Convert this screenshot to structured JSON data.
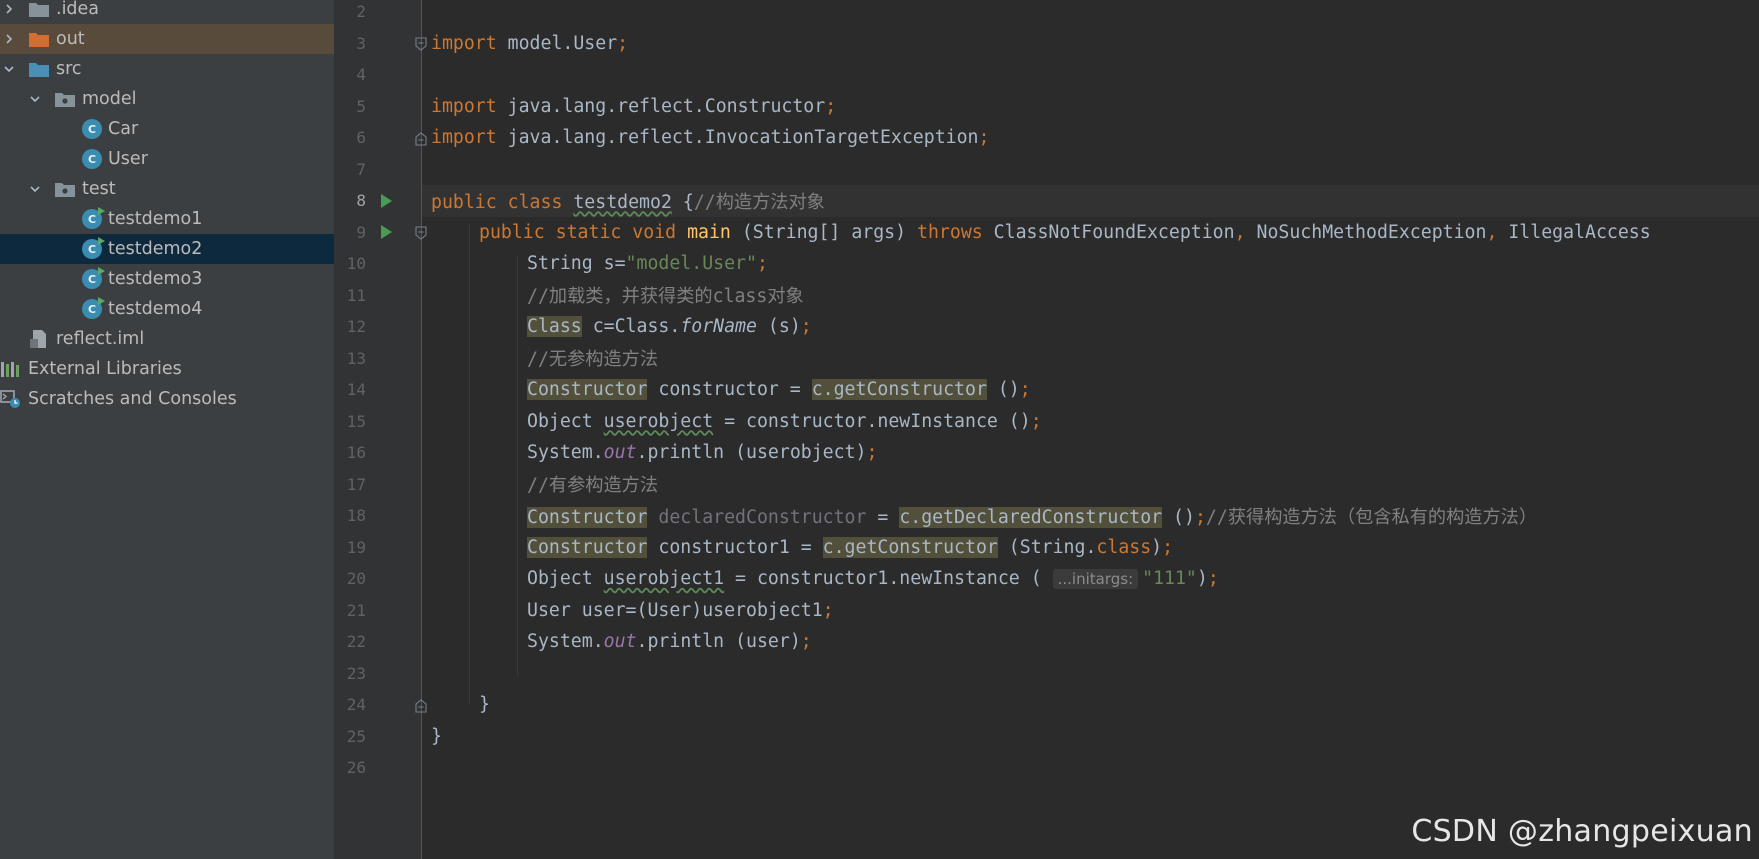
{
  "tree": {
    "items": [
      {
        "label": ".idea",
        "icon": "folder-icon",
        "expanded": false,
        "depth": 0
      },
      {
        "label": "out",
        "icon": "folder-orange-icon",
        "expanded": false,
        "depth": 0
      },
      {
        "label": "src",
        "icon": "folder-source-icon",
        "expanded": true,
        "depth": 0
      },
      {
        "label": "model",
        "icon": "package-icon",
        "expanded": true,
        "depth": 1
      },
      {
        "label": "Car",
        "icon": "class-icon",
        "depth": 2
      },
      {
        "label": "User",
        "icon": "class-icon",
        "depth": 2
      },
      {
        "label": "test",
        "icon": "package-icon",
        "expanded": true,
        "depth": 1
      },
      {
        "label": "testdemo1",
        "icon": "runnable-class-icon",
        "depth": 2
      },
      {
        "label": "testdemo2",
        "icon": "runnable-class-icon",
        "depth": 2,
        "selected": true
      },
      {
        "label": "testdemo3",
        "icon": "runnable-class-icon",
        "depth": 2
      },
      {
        "label": "testdemo4",
        "icon": "runnable-class-icon",
        "depth": 2
      },
      {
        "label": "reflect.iml",
        "icon": "module-file-icon",
        "depth": 1
      },
      {
        "label": "External Libraries",
        "icon": "libraries-icon",
        "depth": 0
      },
      {
        "label": "Scratches and Consoles",
        "icon": "scratches-icon",
        "depth": 0
      }
    ]
  },
  "editor": {
    "current_line": 8,
    "line_numbers": [
      "2",
      "3",
      "4",
      "5",
      "6",
      "7",
      "8",
      "9",
      "10",
      "11",
      "12",
      "13",
      "14",
      "15",
      "16",
      "17",
      "18",
      "19",
      "20",
      "21",
      "22",
      "23",
      "24",
      "25",
      "26"
    ],
    "code": {
      "l3_import": "import",
      "l3_rest": " model.User",
      "semi": ";",
      "l5_rest": " java.lang.reflect.Constructor",
      "l6_rest": " java.lang.reflect.InvocationTargetException",
      "l8_public": "public",
      "l8_class": "class",
      "l8_name": "testdemo2",
      "l8_brace": " {",
      "l8_comment": "//构造方法对象",
      "l9_mods": "public static void",
      "l9_main": "main",
      "l9_params": " (String[] args) ",
      "l9_throws": "throws",
      "l9_ex1": " ClassNotFoundException",
      "comma": ",",
      "l9_ex2": " NoSuchMethodException",
      "l9_ex3": " IllegalAccess",
      "l10_a": "String s=",
      "l10_str": "\"model.User\"",
      "l11_comment": "//加载类，并获得类的class对象",
      "l12_class": "Class",
      "l12_a": " c=Class.",
      "l12_forname": "forName",
      "l12_b": " (s)",
      "l13_comment": "//无参构造方法",
      "constructor_type": "Constructor",
      "l14_a": " constructor = ",
      "l14_call": "c.getConstructor",
      "l14_b": " ()",
      "l15_a": "Object ",
      "l15_var": "userobject",
      "l15_b": " = constructor.newInstance ()",
      "l16_a": "System.",
      "out": "out",
      "l16_b": ".println (userobject)",
      "l17_comment": "//有参构造方法",
      "l18_var": "declaredConstructor",
      "l18_eq": " = ",
      "l18_call": "c.getDeclaredConstructor",
      "l18_b": " ()",
      "l18_comment": "//获得构造方法（包含私有的构造方法）",
      "l19_a": " constructor1 = ",
      "l19_call": "c.getConstructor",
      "l19_b": " (String.",
      "l19_class": "class",
      "l19_c": ")",
      "l20_a": "Object ",
      "l20_var": "userobject1",
      "l20_b": " = constructor1.newInstance ( ",
      "l20_hint": "...initargs:",
      "l20_str": "\"111\"",
      "l20_c": ")",
      "l21_a": "User user=(User)userobject1",
      "l22_b": ".println (user)",
      "l24": "}",
      "l25": "}"
    }
  },
  "watermark": "CSDN @zhangpeixuan",
  "colors": {
    "tree_bg": "#3c3f41",
    "editor_bg": "#2b2b2b",
    "keyword": "#cc7832",
    "string": "#6a8759",
    "comment": "#808080",
    "method": "#ffc66d",
    "static_field": "#9876aa",
    "selection": "#0d293e"
  }
}
